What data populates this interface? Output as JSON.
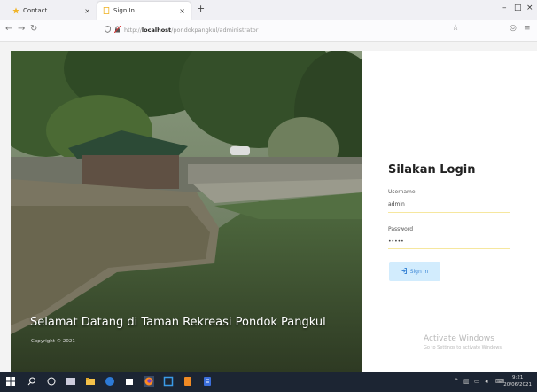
{
  "browser": {
    "tabs": [
      {
        "label": "Contact"
      },
      {
        "label": "Sign In"
      }
    ],
    "new_tab_label": "+",
    "address_bar": {
      "scheme": "http://",
      "host": "localhost",
      "path": "/pondokpangkul/administrator"
    },
    "window_buttons": {
      "minimize": "–",
      "maximize": "□",
      "close": "×"
    }
  },
  "hero": {
    "title": "Selamat Datang di Taman Rekreasi Pondok Pangkul",
    "copyright": "Copyright © 2021"
  },
  "login": {
    "title": "Silakan Login",
    "username_label": "Username",
    "username_value": "admin",
    "password_label": "Password",
    "password_value": "•••••",
    "signin_label": "Sign In"
  },
  "watermark": {
    "line1": "Activate Windows",
    "line2": "Go to Settings to activate Windows."
  },
  "taskbar": {
    "time": "9:21",
    "date": "20/06/2021"
  },
  "colors": {
    "accent": "#3d87d6",
    "button_bg": "#d2ecfd",
    "input_underline": "#f6e79e",
    "taskbar": "#1c2533"
  }
}
